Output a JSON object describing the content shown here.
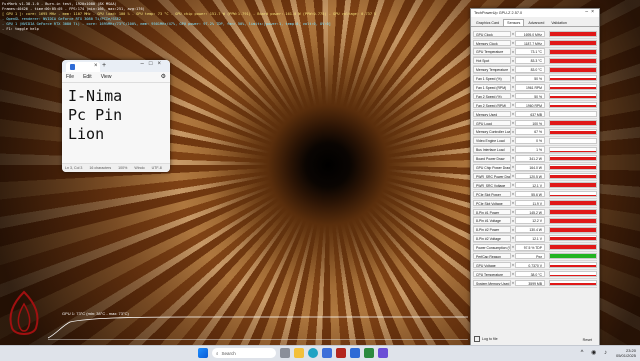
{
  "furmark": {
    "lines": [
      {
        "text": "FurMark v1.38.1.0 - Burn-in test, 1920x1080 (8X MSAA)",
        "color": "#ffffff"
      },
      {
        "text": "Frames:40426 - time:00:05:05 - FPS:174 (min:166, max:251, avg:176)",
        "color": "#ffffff"
      },
      {
        "text": "[ GPU 1 ]: core: 1695 MHz - mem: 1107 MHz - GPU load: 100 % - GPU temp: 73 °C - GPU chip power: 151.7 W (PPW:1.791) - Board power: 161.0 W (PPW:0.775) - GPU voltage: 0.737 V",
        "color": "#f5e27a"
      },
      {
        "text": "- OpenGL renderer: NVIDIA GeForce RTX 3080 Ti/PCIe/SSE2",
        "color": "#7fe3ff"
      },
      {
        "text": "- GPU 1 (NVIDIA GeForce RTX 3080 Ti) - core: 1695MHz/73°C/100%, mem: 9501MHz/47%, GPU power: 97.2% TDP, fan: 50%, limits:[power:1, temp:0, volt:0, OV:0]",
        "color": "#7fe3ff"
      },
      {
        "text": "- F1: toggle help",
        "color": "#ffffff"
      }
    ],
    "graph_label": "GPU 1: 73°C (min: 38°C - max: 73°C)"
  },
  "notepad": {
    "menu": [
      "File",
      "Edit",
      "View"
    ],
    "lines": [
      "I-Nima",
      "Pc Pin",
      "Lion"
    ],
    "status": [
      "Ln 3, Col 3",
      "16 characters",
      "100%",
      "Windo",
      "UTF-8"
    ]
  },
  "gpuz": {
    "title": "TechPowerUp GPU-Z 2.57.0",
    "tabs": [
      "Graphics Card",
      "Sensors",
      "Advanced",
      "Validation"
    ],
    "active_tab": "Sensors",
    "rows": [
      {
        "label": "GPU Clock",
        "value": "1695.0 MHz",
        "level": 0.95
      },
      {
        "label": "Memory Clock",
        "value": "1187.7 MHz",
        "level": 0.95
      },
      {
        "label": "GPU Temperature",
        "value": "73.1 °C",
        "level": 0.9
      },
      {
        "label": "Hot Spot",
        "value": "83.3 °C",
        "level": 0.92
      },
      {
        "label": "Memory Temperature",
        "value": "83.0 °C",
        "level": 0.9
      },
      {
        "label": "Fan 1 Speed (%)",
        "value": "50 %",
        "level": 0.55
      },
      {
        "label": "Fan 1 Speed (RPM)",
        "value": "1961 RPM",
        "level": 0.55
      },
      {
        "label": "Fan 2 Speed (%)",
        "value": "50 %",
        "level": 0.55
      },
      {
        "label": "Fan 2 Speed (RPM)",
        "value": "1960 RPM",
        "level": 0.55
      },
      {
        "label": "Memory Used",
        "value": "637 MB",
        "level": 0.1
      },
      {
        "label": "GPU Load",
        "value": "100 %",
        "level": 1.0
      },
      {
        "label": "Memory Controller Load",
        "value": "67 %",
        "level": 0.67
      },
      {
        "label": "Video Engine Load",
        "value": "0 %",
        "level": 0
      },
      {
        "label": "Bus Interface Load",
        "value": "1 %",
        "level": 0.02
      },
      {
        "label": "Board Power Draw",
        "value": "341.2 W",
        "level": 0.95
      },
      {
        "label": "GPU Chip Power Draw",
        "value": "164.0 W",
        "level": 0.8
      },
      {
        "label": "PWR_SRC Power Draw",
        "value": "120.5 W",
        "level": 0.8
      },
      {
        "label": "PWR_SRC Voltage",
        "value": "12.1 V",
        "level": 0.95
      },
      {
        "label": "PCIe Slot Power",
        "value": "55.6 W",
        "level": 0.3
      },
      {
        "label": "PCIe Slot Voltage",
        "value": "11.9 V",
        "level": 0.95
      },
      {
        "label": "8-Pin #1 Power",
        "value": "145.2 W",
        "level": 0.85
      },
      {
        "label": "8-Pin #1 Voltage",
        "value": "12.2 V",
        "level": 0.95
      },
      {
        "label": "8-Pin #2 Power",
        "value": "130.4 W",
        "level": 0.8
      },
      {
        "label": "8-Pin #2 Voltage",
        "value": "12.1 V",
        "level": 0.95
      },
      {
        "label": "Power Consumption (%)",
        "value": "97.5 % TDP",
        "level": 0.97
      },
      {
        "label": "PerfCap Reason",
        "value": "Pwr",
        "level": 1.0,
        "color": "#22b422"
      },
      {
        "label": "GPU Voltage",
        "value": "0.7370 V",
        "level": 0.5
      },
      {
        "label": "CPU Temperature",
        "value": "38.0 °C",
        "level": 0.3
      },
      {
        "label": "System Memory Used",
        "value": "3599 MB",
        "level": 0.35
      }
    ],
    "log_label": "Log to file",
    "reset_label": "Reset",
    "bar_color": "#e01818"
  },
  "taskbar": {
    "search": "Search",
    "time": "23:20",
    "date": "05/01/2025"
  }
}
